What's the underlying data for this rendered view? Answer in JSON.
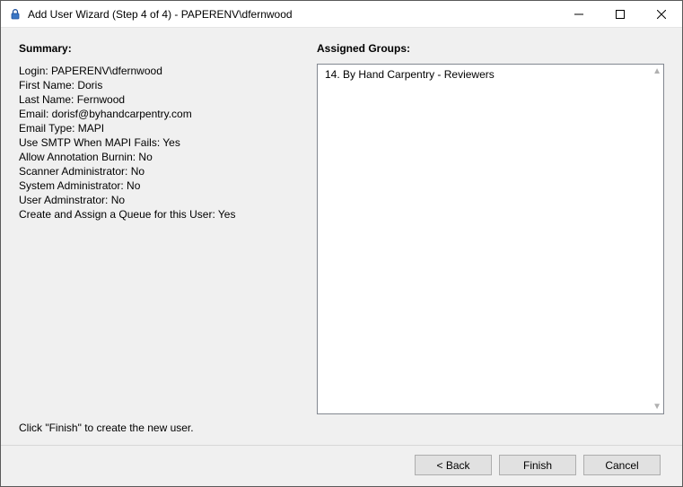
{
  "window": {
    "title": "Add User Wizard (Step 4 of 4) - PAPERENV\\dfernwood"
  },
  "summary": {
    "heading": "Summary:",
    "lines": [
      "Login: PAPERENV\\dfernwood",
      "First Name: Doris",
      "Last Name: Fernwood",
      "Email: dorisf@byhandcarpentry.com",
      "Email Type: MAPI",
      "Use SMTP When MAPI Fails: Yes",
      "Allow Annotation Burnin: No",
      "Scanner Administrator: No",
      "System Administrator: No",
      "User Adminstrator: No",
      "Create and Assign a Queue for this User: Yes"
    ]
  },
  "groups": {
    "heading": "Assigned Groups:",
    "items": [
      "14. By Hand Carpentry - Reviewers"
    ]
  },
  "hint": "Click \"Finish\" to create the new user.",
  "buttons": {
    "back": "< Back",
    "finish": "Finish",
    "cancel": "Cancel"
  }
}
